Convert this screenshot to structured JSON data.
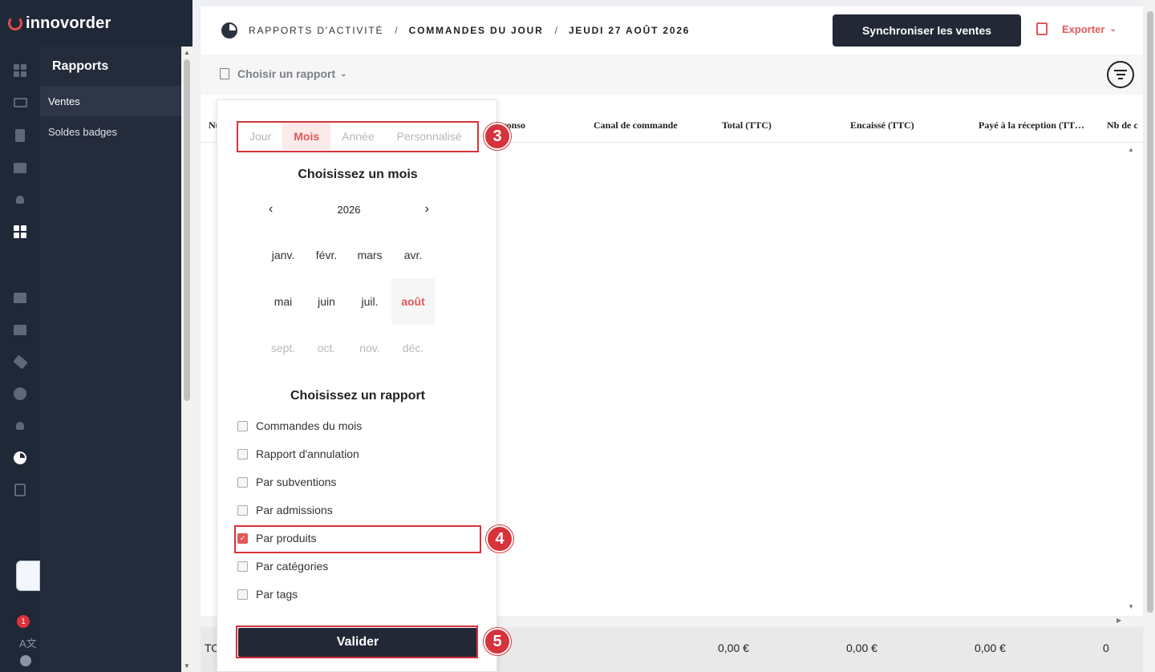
{
  "brand": {
    "name": "innovorder",
    "accent": "#e2585a"
  },
  "rail": {
    "icons": [
      "dashboard-icon",
      "card-icon",
      "clipboard-icon",
      "store-icon",
      "user-icon",
      "grid-icon",
      "store2-icon",
      "gift-icon",
      "tags-icon",
      "globe-icon",
      "branch-icon",
      "reports-pie-icon",
      "import-icon"
    ],
    "notification_count": "1",
    "lang_glyph": "A文"
  },
  "subnav": {
    "title": "Rapports",
    "items": [
      {
        "label": "Ventes",
        "active": true
      },
      {
        "label": "Soldes badges",
        "active": false
      }
    ]
  },
  "header": {
    "breadcrumb": [
      "Rapports d'activité",
      "Commandes du jour",
      "Jeudi 27 août 2026"
    ],
    "sync_label": "Synchroniser les ventes",
    "export_label": "Exporter"
  },
  "toolbar": {
    "choose_label": "Choisir un rapport"
  },
  "table": {
    "headers": [
      "Nu",
      "e conso",
      "Canal de commande",
      "Total (TTC)",
      "Encaissé (TTC)",
      "Payé à la réception (TT…",
      "Nb de c"
    ],
    "footer": [
      "TO",
      "0,00 €",
      "0,00 €",
      "0,00 €",
      "0"
    ]
  },
  "panel": {
    "tabs": [
      {
        "label": "Jour",
        "active": false
      },
      {
        "label": "Mois",
        "active": true
      },
      {
        "label": "Année",
        "active": false
      },
      {
        "label": "Personnalisé",
        "active": false
      }
    ],
    "month_title": "Choisissez un mois",
    "year": "2026",
    "months": [
      {
        "label": "janv.",
        "state": "normal"
      },
      {
        "label": "févr.",
        "state": "normal"
      },
      {
        "label": "mars",
        "state": "normal"
      },
      {
        "label": "avr.",
        "state": "normal"
      },
      {
        "label": "mai",
        "state": "normal"
      },
      {
        "label": "juin",
        "state": "normal"
      },
      {
        "label": "juil.",
        "state": "normal"
      },
      {
        "label": "août",
        "state": "selected"
      },
      {
        "label": "sept.",
        "state": "disabled"
      },
      {
        "label": "oct.",
        "state": "disabled"
      },
      {
        "label": "nov.",
        "state": "disabled"
      },
      {
        "label": "déc.",
        "state": "disabled"
      }
    ],
    "report_title": "Choisissez un rapport",
    "reports": [
      {
        "label": "Commandes du mois",
        "checked": false
      },
      {
        "label": "Rapport d'annulation",
        "checked": false
      },
      {
        "label": "Par subventions",
        "checked": false
      },
      {
        "label": "Par admissions",
        "checked": false
      },
      {
        "label": "Par produits",
        "checked": true
      },
      {
        "label": "Par catégories",
        "checked": false
      },
      {
        "label": "Par tags",
        "checked": false
      }
    ],
    "validate_label": "Valider"
  },
  "steps": [
    "3",
    "4",
    "5"
  ],
  "colors": {
    "highlight": "#d6333b",
    "dark": "#222835",
    "rail": "#1f2837"
  }
}
